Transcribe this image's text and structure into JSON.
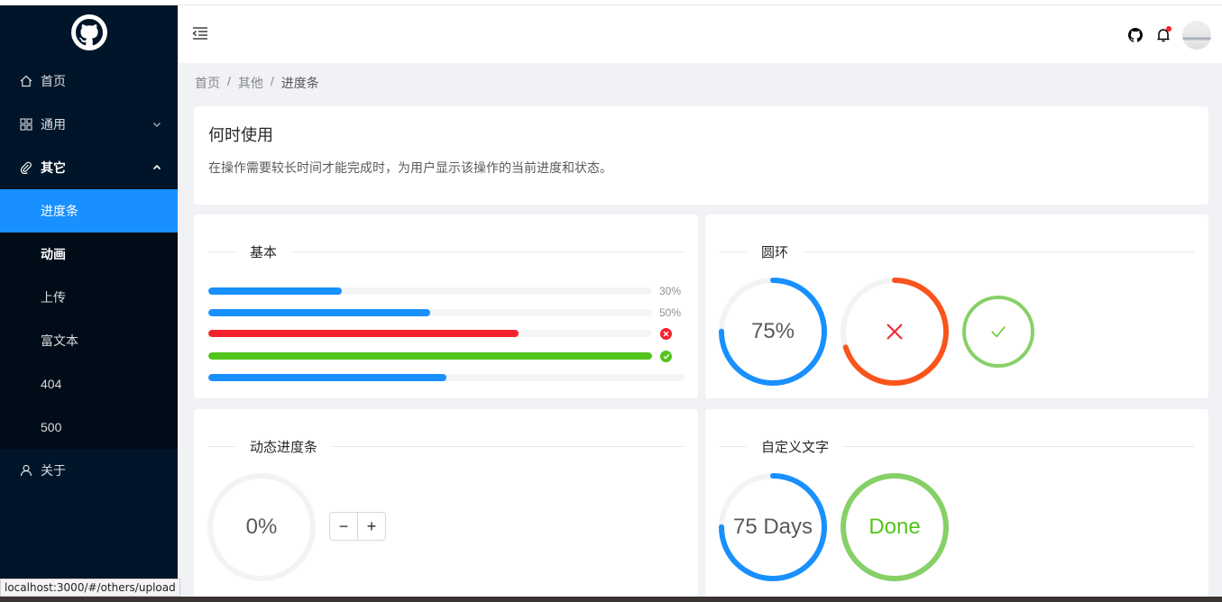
{
  "sidebar": {
    "items": [
      {
        "label": "首页",
        "icon": "home-icon"
      },
      {
        "label": "通用",
        "icon": "appstore-icon"
      },
      {
        "label": "其它",
        "icon": "paperclip-icon"
      },
      {
        "label": "关于",
        "icon": "user-icon"
      }
    ],
    "submenu": [
      {
        "label": "进度条"
      },
      {
        "label": "动画"
      },
      {
        "label": "上传"
      },
      {
        "label": "富文本"
      },
      {
        "label": "404"
      },
      {
        "label": "500"
      }
    ]
  },
  "breadcrumb": [
    "首页",
    "其他",
    "进度条"
  ],
  "intro": {
    "title": "何时使用",
    "description": "在操作需要较长时间才能完成时，为用户显示该操作的当前进度和状态。"
  },
  "basic": {
    "title": "基本",
    "bars": [
      {
        "percent": 30,
        "label": "30%",
        "status": "normal",
        "color": "#1890ff"
      },
      {
        "percent": 50,
        "label": "50%",
        "status": "normal",
        "color": "#1890ff"
      },
      {
        "percent": 70,
        "label": "",
        "status": "exception",
        "color": "#f5222d"
      },
      {
        "percent": 100,
        "label": "",
        "status": "success",
        "color": "#52c41a"
      },
      {
        "percent": 50,
        "label": "",
        "status": "no-info",
        "color": "#1890ff"
      }
    ]
  },
  "circles": {
    "title": "圆环",
    "items": [
      {
        "percent": 75,
        "label": "75%",
        "color": "#1890ff",
        "status": "normal"
      },
      {
        "percent": 70,
        "label": "",
        "color": "#fa541c",
        "status": "exception",
        "icon": "close-icon"
      },
      {
        "percent": 100,
        "label": "",
        "color": "#87d068",
        "status": "success",
        "icon": "check-icon"
      }
    ]
  },
  "dynamic": {
    "title": "动态进度条",
    "percent": 0,
    "label": "0%",
    "minus": "−",
    "plus": "+"
  },
  "custom": {
    "title": "自定义文字",
    "items": [
      {
        "percent": 75,
        "label": "75 Days",
        "color": "#1890ff"
      },
      {
        "percent": 100,
        "label": "Done",
        "color": "#87d068"
      }
    ]
  },
  "statusbar": {
    "url": "localhost:3000/#/others/upload"
  },
  "colors": {
    "primary": "#1890ff",
    "danger": "#f5222d",
    "success": "#52c41a",
    "sider": "#001529"
  }
}
